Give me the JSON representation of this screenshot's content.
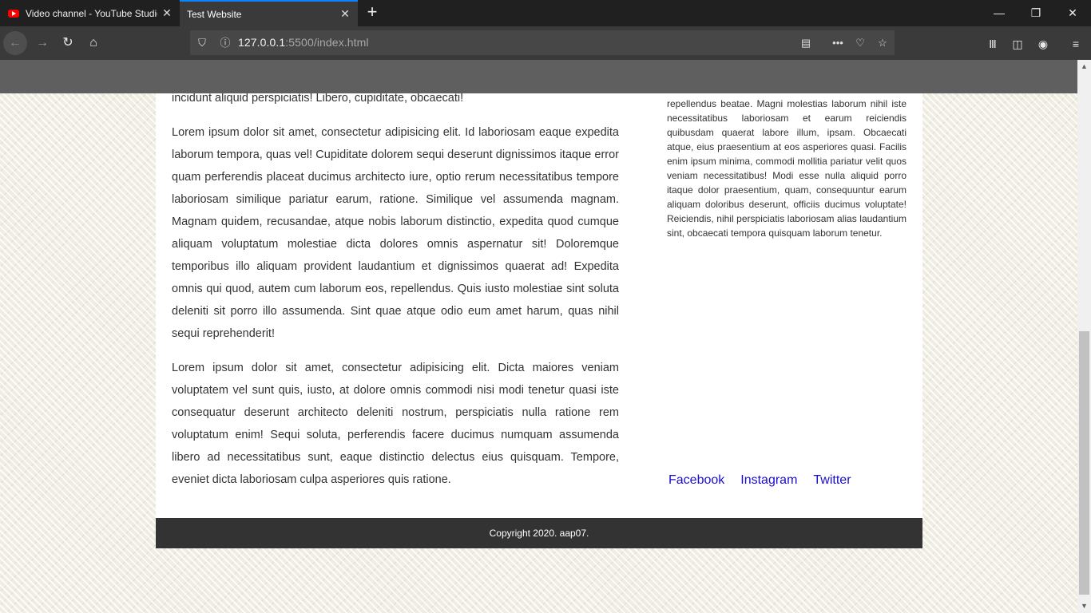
{
  "browser": {
    "tabs": [
      {
        "title": "Video channel - YouTube Studio",
        "favicon": "youtube-icon"
      },
      {
        "title": "Test Website"
      }
    ],
    "url_host": "127.0.0.1",
    "url_rest": ":5500/index.html"
  },
  "page": {
    "clipped_line": "incidunt aliquid perspiciatis! Libero, cupiditate, obcaecati!",
    "paragraphs": [
      "Lorem ipsum dolor sit amet, consectetur adipisicing elit. Id laboriosam eaque expedita laborum tempora, quas vel! Cupiditate dolorem sequi deserunt dignissimos itaque error quam perferendis placeat ducimus architecto iure, optio rerum necessitatibus tempore laboriosam similique pariatur earum, ratione. Similique vel assumenda magnam. Magnam quidem, recusandae, atque nobis laborum distinctio, expedita quod cumque aliquam voluptatum molestiae dicta dolores omnis aspernatur sit! Doloremque temporibus illo aliquam provident laudantium et dignissimos quaerat ad! Expedita omnis qui quod, autem cum laborum eos, repellendus. Quis iusto molestiae sint soluta deleniti sit porro illo assumenda. Sint quae atque odio eum amet harum, quas nihil sequi reprehenderit!",
      "Lorem ipsum dolor sit amet, consectetur adipisicing elit. Dicta maiores veniam voluptatem vel sunt quis, iusto, at dolore omnis commodi nisi modi tenetur quasi iste consequatur deserunt architecto deleniti nostrum, perspiciatis nulla ratione rem voluptatum enim! Sequi soluta, perferendis facere ducimus numquam assumenda libero ad necessitatibus sunt, eaque distinctio delectus eius quisquam. Tempore, eveniet dicta laboriosam culpa asperiores quis ratione."
    ],
    "sidebar_text": "repellendus beatae. Magni molestias laborum nihil iste necessitatibus laboriosam et earum reiciendis quibusdam quaerat labore illum, ipsam. Obcaecati atque, eius praesentium at eos asperiores quasi. Facilis enim ipsum minima, commodi mollitia pariatur velit quos veniam necessitatibus! Modi esse nulla aliquid porro itaque dolor praesentium, quam, consequuntur earum aliquam doloribus deserunt, officiis ducimus voluptate! Reiciendis, nihil perspiciatis laboriosam alias laudantium sint, obcaecati tempora quisquam laborum tenetur.",
    "social": {
      "facebook": "Facebook",
      "instagram": "Instagram",
      "twitter": "Twitter"
    },
    "footer": "Copyright 2020. aap07."
  }
}
